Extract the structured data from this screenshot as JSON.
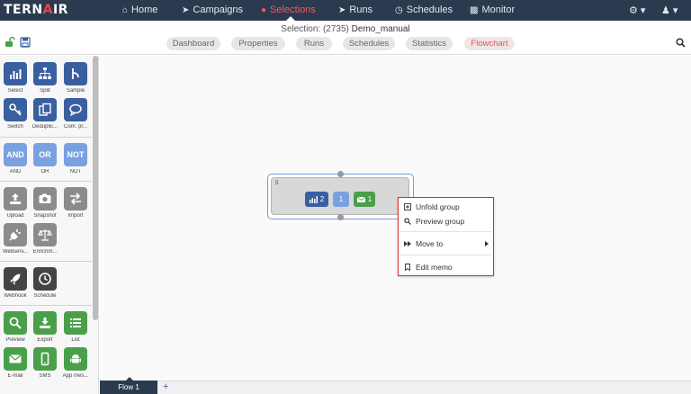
{
  "app": {
    "logo_left": "TERN",
    "logo_dot": "A",
    "logo_right": "IR"
  },
  "nav": {
    "items": [
      {
        "label": "Home",
        "icon": "home-icon"
      },
      {
        "label": "Campaigns",
        "icon": "campaigns-icon"
      },
      {
        "label": "Selections",
        "icon": "selections-icon",
        "active": true
      },
      {
        "label": "Runs",
        "icon": "runs-icon"
      },
      {
        "label": "Schedules",
        "icon": "schedules-icon"
      },
      {
        "label": "Monitor",
        "icon": "monitor-icon"
      }
    ],
    "settings_icon": "gear-icon",
    "user_icon": "user-icon"
  },
  "selection": {
    "prefix": "Selection: (2735)",
    "name": "Demo_manual"
  },
  "subtabs": [
    "Dashboard",
    "Properties",
    "Runs",
    "Schedules",
    "Statistics",
    "Flowchart"
  ],
  "active_subtab": "Flowchart",
  "palette": {
    "row1": [
      "Select",
      "Split",
      "Sample"
    ],
    "row2": [
      "Switch",
      "Deduplic...",
      "Com. pr..."
    ],
    "row3": [
      "AND",
      "OR",
      "NOT"
    ],
    "row4": [
      "Upload",
      "Snapshot",
      "Import"
    ],
    "row5": [
      "Webserv...",
      "Enrichm..."
    ],
    "row6": [
      "Webhook",
      "Schedule"
    ],
    "row7": [
      "Preview",
      "Export",
      "List"
    ],
    "row8": [
      "E-mail",
      "SMS",
      "App mes..."
    ]
  },
  "flow": {
    "group_number": "5",
    "nodes": [
      {
        "count": "2",
        "type": "select",
        "color": "#3a5fa0"
      },
      {
        "count": "1",
        "type": "or",
        "color": "#7aa1df"
      },
      {
        "count": "1",
        "type": "email",
        "color": "#4aa04a"
      }
    ]
  },
  "context_menu": {
    "items": [
      {
        "label": "Unfold group",
        "icon": "unfold-icon"
      },
      {
        "label": "Preview group",
        "icon": "search-icon"
      },
      {
        "label": "Move to",
        "icon": "fast-forward-icon",
        "submenu": true
      },
      {
        "label": "Edit memo",
        "icon": "bookmark-icon"
      }
    ]
  },
  "bottom": {
    "flow_tab": "Flow 1",
    "add_label": "+"
  },
  "colors": {
    "nav_bg": "#2b3a4f",
    "accent_red": "#e05555",
    "blue": "#3a5fa0",
    "green": "#4aa04a",
    "menu_border": "#d9302c"
  }
}
